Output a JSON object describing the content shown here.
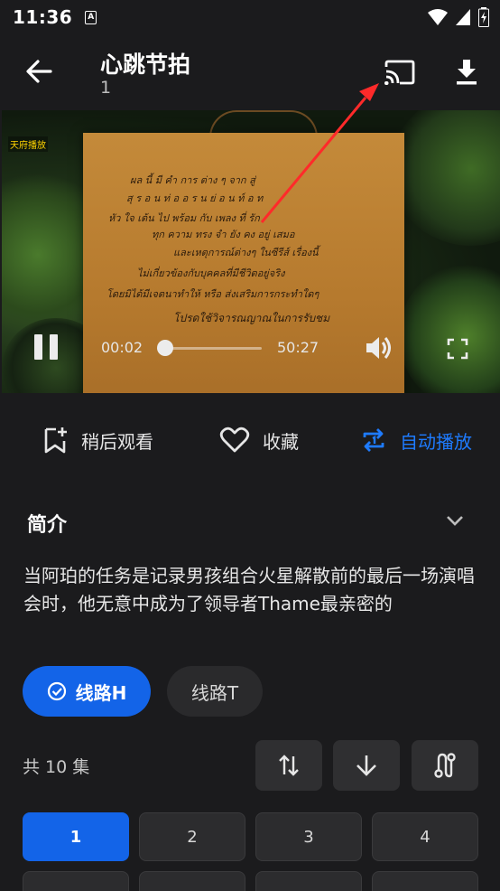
{
  "status_bar": {
    "time": "11:36",
    "notif_letter": "A"
  },
  "header": {
    "title": "心跳节拍",
    "episode": "1"
  },
  "player": {
    "watermark": "天府播放",
    "current_time": "00:02",
    "total_time": "50:27",
    "progress": 0.0007,
    "sign_lines": [
      "ผล นี้ มี คำ การ ต่าง ๆ จาก สู่",
      "สุ ร อ น ท่ อ อ ร น ย่ อ น ท์ อ ท",
      "หัว ใจ เต้น ไป พร้อม กับ เพลง ที่ รัก",
      "ทุก ความ ทรง จำ ยัง คง อยู่ เสมอ",
      "และเหตุการณ์ต่างๆ ในซีรีส์ เรื่องนี้",
      "ไม่เกี่ยวข้องกับบุคคลที่มีชีวิตอยู่จริง",
      "โดยมิได้มีเจตนาทำให้ หรือ ส่งเสริมการกระทำใดๆ",
      "โปรดใช้วิจารณญาณในการรับชม"
    ]
  },
  "actions": {
    "watch_later": "稍后观看",
    "favorite": "收藏",
    "autoplay": "自动播放"
  },
  "intro": {
    "title": "简介",
    "text": "当阿珀的任务是记录男孩组合火星解散前的最后一场演唱会时，他无意中成为了领导者Thame最亲密的"
  },
  "routes": {
    "route_h": "线路H",
    "route_t": "线路T"
  },
  "episodes": {
    "count_label": "共 10 集",
    "items": [
      "1",
      "2",
      "3",
      "4"
    ]
  },
  "colors": {
    "accent": "#1364e8",
    "autoplay": "#1e7bff",
    "annotation_arrow": "#ff2a2a"
  }
}
